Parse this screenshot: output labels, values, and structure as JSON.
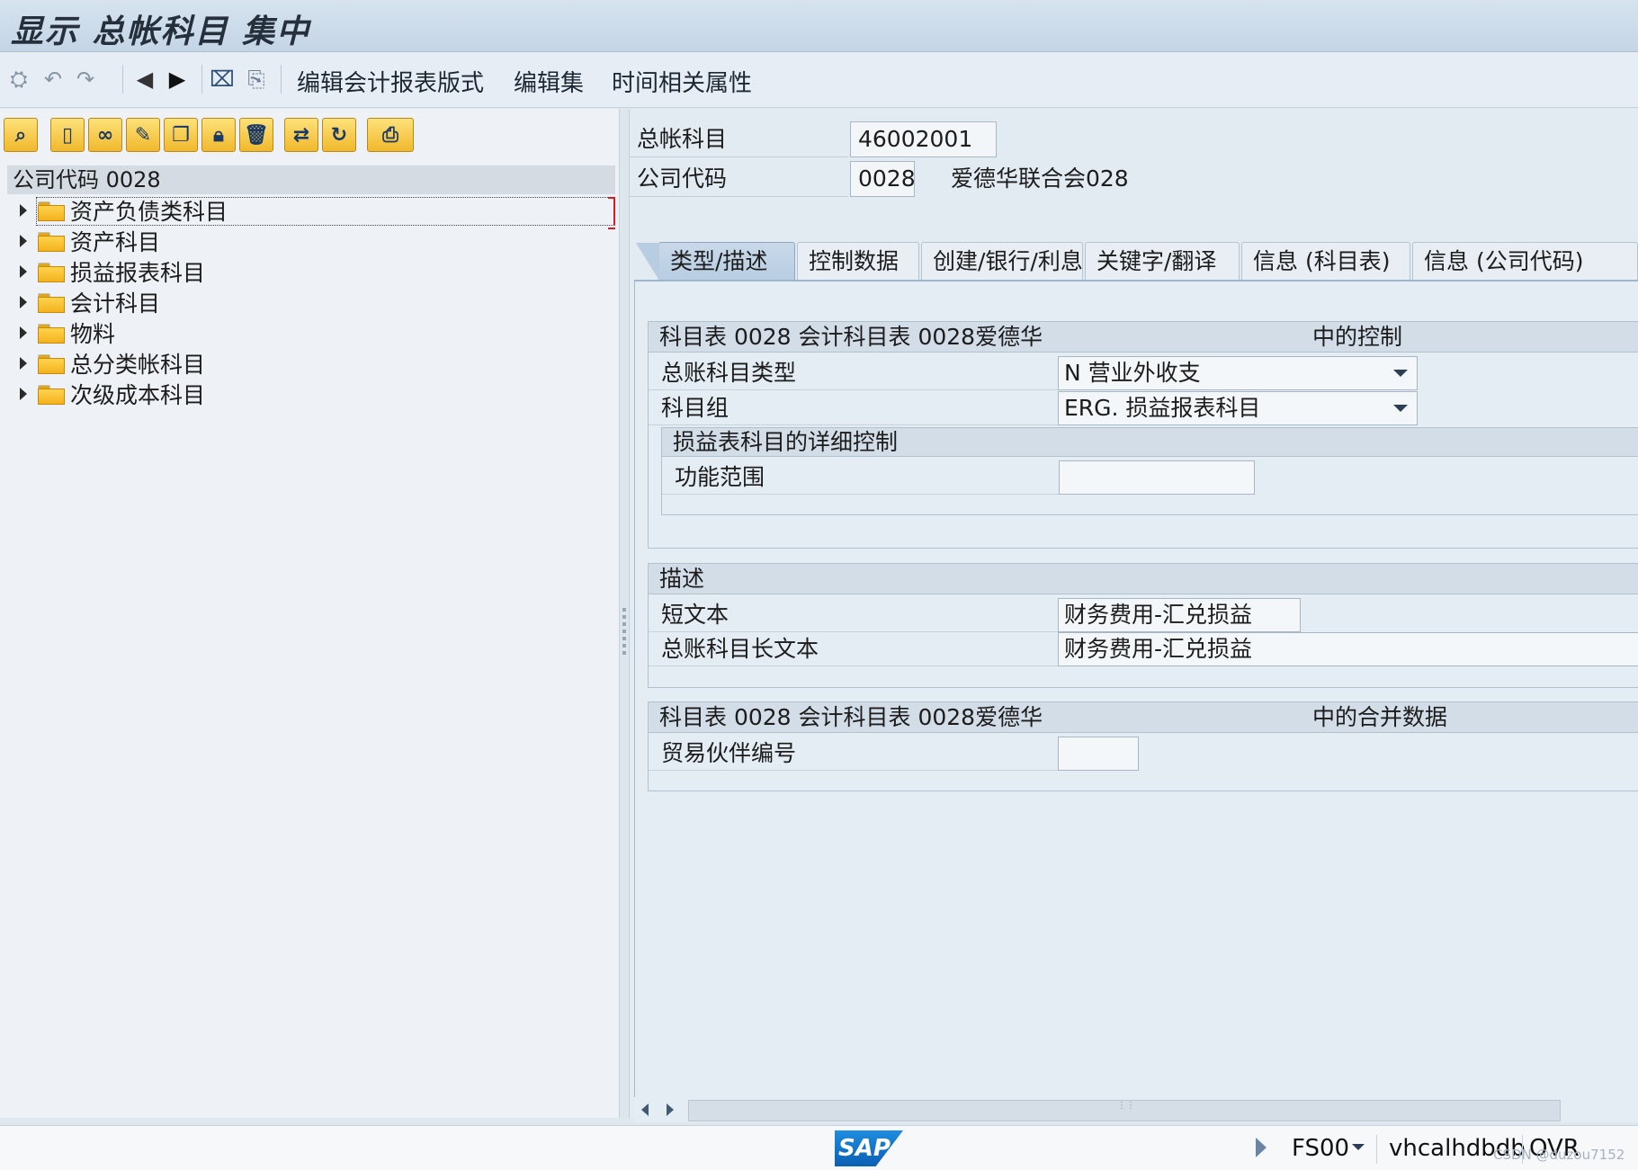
{
  "window": {
    "title": "显示 总帐科目 集中"
  },
  "app_toolbar": {
    "icons": [
      "master-data-icon",
      "undo-icon",
      "redo-icon",
      "previous-icon",
      "next-icon",
      "delete-entry-icon",
      "display-other-icon"
    ],
    "buttons": [
      "编辑会计报表版式",
      "编辑集",
      "时间相关属性"
    ]
  },
  "left_toolbar": {
    "icons": [
      "find-icon",
      "create-icon",
      "display-icon",
      "change-icon",
      "copy-icon",
      "lock-icon",
      "delete-icon",
      "expand-icon",
      "refresh-icon",
      "print-icon"
    ]
  },
  "tree": {
    "header": "公司代码 0028",
    "items": [
      {
        "label": "资产负债类科目",
        "selected": true
      },
      {
        "label": "资产科目"
      },
      {
        "label": "损益报表科目"
      },
      {
        "label": "会计科目"
      },
      {
        "label": "物料"
      },
      {
        "label": "总分类帐科目"
      },
      {
        "label": "次级成本科目"
      }
    ]
  },
  "header_fields": {
    "gl_account_label": "总帐科目",
    "gl_account_value": "46002001",
    "company_code_label": "公司代码",
    "company_code_value": "0028",
    "company_name": "爱德华联合会028"
  },
  "tabs": [
    {
      "label": "类型/描述",
      "active": true
    },
    {
      "label": "控制数据"
    },
    {
      "label": "创建/银行/利息"
    },
    {
      "label": "关键字/翻译"
    },
    {
      "label": "信息 (科目表)"
    },
    {
      "label": "信息 (公司代码)"
    }
  ],
  "control_group": {
    "title_left": "科目表 0028 会计科目表 0028爱德华",
    "title_right": "中的控制",
    "account_type_label": "总账科目类型",
    "account_type_value": "N 营业外收支",
    "account_group_label": "科目组",
    "account_group_value": "ERG. 损益报表科目",
    "pl_detail_title": "损益表科目的详细控制",
    "functional_area_label": "功能范围",
    "functional_area_value": ""
  },
  "description_group": {
    "title": "描述",
    "short_text_label": "短文本",
    "short_text_value": "财务费用-汇兑损益",
    "long_text_label": "总账科目长文本",
    "long_text_value": "财务费用-汇兑损益"
  },
  "consolidation_group": {
    "title_left": "科目表 0028 会计科目表 0028爱德华",
    "title_right": "中的合并数据",
    "trading_partner_label": "贸易伙伴编号",
    "trading_partner_value": ""
  },
  "status_bar": {
    "logo": "SAP",
    "transaction": "FS00",
    "server": "vhcalhdbdb",
    "mode": "OVR",
    "watermark": "CSDN @duzou7152"
  }
}
